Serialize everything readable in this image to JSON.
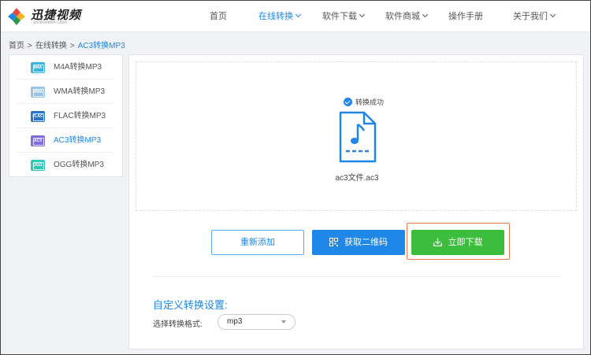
{
  "header": {
    "logo_text": "迅捷视频",
    "logo_sub": "一款好用的视频制作工具软件",
    "nav": [
      {
        "label": "首页",
        "dropdown": false
      },
      {
        "label": "在线转换",
        "dropdown": true,
        "active": true
      },
      {
        "label": "软件下载",
        "dropdown": true
      },
      {
        "label": "软件商城",
        "dropdown": true
      },
      {
        "label": "操作手册",
        "dropdown": false
      },
      {
        "label": "关于我们",
        "dropdown": true
      }
    ]
  },
  "breadcrumb": [
    "首页",
    "在线转换",
    "AC3转换MP3"
  ],
  "breadcrumb_sep": ">",
  "sidebar": {
    "items": [
      {
        "label": "M4A转换MP3",
        "icon": "M4A",
        "icon_color": "#3bb5e6"
      },
      {
        "label": "WMA转换MP3",
        "icon": "WMA",
        "icon_color": "#9ac3e6"
      },
      {
        "label": "FLAC转换MP3",
        "icon": "FLAC",
        "icon_color": "#2a73c9"
      },
      {
        "label": "AC3转换MP3",
        "icon": "AC3",
        "icon_color": "#7c6ce0",
        "active": true
      },
      {
        "label": "OGG转换MP3",
        "icon": "OGG",
        "icon_color": "#2fc9b4"
      }
    ]
  },
  "main": {
    "status": "转换成功",
    "file_name": "ac3文件.ac3",
    "buttons": {
      "re_add": "重新添加",
      "qr": "获取二维码",
      "download": "立即下载"
    },
    "settings_title": "自定义转换设置:",
    "format_label": "选择转换格式:",
    "format_value": "mp3"
  },
  "colors": {
    "accent": "#1f87e8",
    "download": "#3cbd3d",
    "highlight_outline": "#ee7a4a"
  }
}
